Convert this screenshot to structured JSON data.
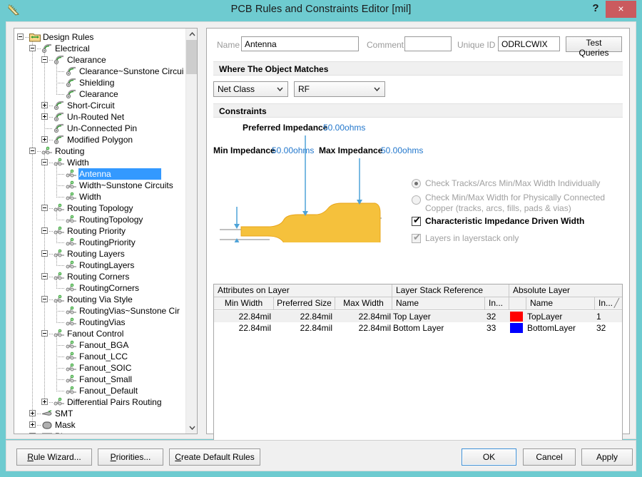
{
  "window": {
    "title": "PCB Rules and Constraints Editor [mil]",
    "help_label": "?",
    "close_label": "×",
    "icon_name": "pcb-ruler-icon"
  },
  "tree": {
    "nodes": [
      {
        "label": "Design Rules",
        "depth": 0,
        "expander": "minus",
        "icon": "folder-rules-icon"
      },
      {
        "label": "Electrical",
        "depth": 1,
        "expander": "minus",
        "icon": "electrical-icon"
      },
      {
        "label": "Clearance",
        "depth": 2,
        "expander": "minus",
        "icon": "electrical-icon"
      },
      {
        "label": "Clearance~Sunstone Circui",
        "depth": 3,
        "expander": "none",
        "icon": "electrical-icon"
      },
      {
        "label": "Shielding",
        "depth": 3,
        "expander": "none",
        "icon": "electrical-icon"
      },
      {
        "label": "Clearance",
        "depth": 3,
        "expander": "none",
        "icon": "electrical-icon"
      },
      {
        "label": "Short-Circuit",
        "depth": 2,
        "expander": "plus",
        "icon": "electrical-icon"
      },
      {
        "label": "Un-Routed Net",
        "depth": 2,
        "expander": "plus",
        "icon": "electrical-icon"
      },
      {
        "label": "Un-Connected Pin",
        "depth": 2,
        "expander": "none",
        "icon": "electrical-icon"
      },
      {
        "label": "Modified Polygon",
        "depth": 2,
        "expander": "plus",
        "icon": "electrical-icon"
      },
      {
        "label": "Routing",
        "depth": 1,
        "expander": "minus",
        "icon": "routing-icon"
      },
      {
        "label": "Width",
        "depth": 2,
        "expander": "minus",
        "icon": "routing-icon"
      },
      {
        "label": "Antenna",
        "depth": 3,
        "expander": "none",
        "icon": "routing-icon",
        "selected": true
      },
      {
        "label": "Width~Sunstone Circuits",
        "depth": 3,
        "expander": "none",
        "icon": "routing-icon"
      },
      {
        "label": "Width",
        "depth": 3,
        "expander": "none",
        "icon": "routing-icon"
      },
      {
        "label": "Routing Topology",
        "depth": 2,
        "expander": "minus",
        "icon": "routing-icon"
      },
      {
        "label": "RoutingTopology",
        "depth": 3,
        "expander": "none",
        "icon": "routing-icon"
      },
      {
        "label": "Routing Priority",
        "depth": 2,
        "expander": "minus",
        "icon": "routing-icon"
      },
      {
        "label": "RoutingPriority",
        "depth": 3,
        "expander": "none",
        "icon": "routing-icon"
      },
      {
        "label": "Routing Layers",
        "depth": 2,
        "expander": "minus",
        "icon": "routing-icon"
      },
      {
        "label": "RoutingLayers",
        "depth": 3,
        "expander": "none",
        "icon": "routing-icon"
      },
      {
        "label": "Routing Corners",
        "depth": 2,
        "expander": "minus",
        "icon": "routing-icon"
      },
      {
        "label": "RoutingCorners",
        "depth": 3,
        "expander": "none",
        "icon": "routing-icon"
      },
      {
        "label": "Routing Via Style",
        "depth": 2,
        "expander": "minus",
        "icon": "routing-icon"
      },
      {
        "label": "RoutingVias~Sunstone Cir",
        "depth": 3,
        "expander": "none",
        "icon": "routing-icon"
      },
      {
        "label": "RoutingVias",
        "depth": 3,
        "expander": "none",
        "icon": "routing-icon"
      },
      {
        "label": "Fanout Control",
        "depth": 2,
        "expander": "minus",
        "icon": "routing-icon"
      },
      {
        "label": "Fanout_BGA",
        "depth": 3,
        "expander": "none",
        "icon": "routing-icon"
      },
      {
        "label": "Fanout_LCC",
        "depth": 3,
        "expander": "none",
        "icon": "routing-icon"
      },
      {
        "label": "Fanout_SOIC",
        "depth": 3,
        "expander": "none",
        "icon": "routing-icon"
      },
      {
        "label": "Fanout_Small",
        "depth": 3,
        "expander": "none",
        "icon": "routing-icon"
      },
      {
        "label": "Fanout_Default",
        "depth": 3,
        "expander": "none",
        "icon": "routing-icon"
      },
      {
        "label": "Differential Pairs Routing",
        "depth": 2,
        "expander": "plus",
        "icon": "routing-icon"
      },
      {
        "label": "SMT",
        "depth": 1,
        "expander": "plus",
        "icon": "smt-icon"
      },
      {
        "label": "Mask",
        "depth": 1,
        "expander": "plus",
        "icon": "mask-icon"
      },
      {
        "label": "Plane",
        "depth": 1,
        "expander": "minus",
        "icon": "plane-icon"
      }
    ],
    "scroll_up_label": "▲",
    "scroll_down_label": "▼"
  },
  "rule": {
    "name_label": "Name",
    "name_value": "Antenna",
    "comment_label": "Comment",
    "comment_value": "",
    "unique_id_label": "Unique ID",
    "unique_id_value": "ODRLCWIX",
    "test_queries_label": "Test Queries"
  },
  "where": {
    "header": "Where The Object Matches",
    "scope_value": "Net Class",
    "target_value": "RF"
  },
  "constraints": {
    "header": "Constraints",
    "preferred_impedance_label": "Preferred Impedance",
    "preferred_impedance_value": "50.00ohms",
    "min_impedance_label": "Min Impedance",
    "min_impedance_value": "50.00ohms",
    "max_impedance_label": "Max Impedance",
    "max_impedance_value": "50.00ohms",
    "radio_individual": "Check Tracks/Arcs Min/Max Width Individually",
    "radio_connected_line1": "Check Min/Max Width for Physically Connected",
    "radio_connected_line2": "Copper (tracks, arcs, fills, pads & vias)",
    "check_impedance_driven": "Characteristic Impedance Driven Width",
    "check_layers_only": "Layers in layerstack only",
    "checkmark": "✔"
  },
  "grid": {
    "group_headers": [
      "Attributes on Layer",
      "Layer Stack Reference",
      "Absolute Layer"
    ],
    "columns": [
      "Min Width",
      "Preferred Size",
      "Max Width",
      "Name",
      "In...",
      "",
      "Name",
      "In..."
    ],
    "sort_indicator": "╱",
    "rows": [
      {
        "min_width": "22.84mil",
        "preferred_size": "22.84mil",
        "max_width": "22.84mil",
        "stack_name": "Top Layer",
        "stack_index": "32",
        "color": "#ff0000",
        "abs_name": "TopLayer",
        "abs_index": "1"
      },
      {
        "min_width": "22.84mil",
        "preferred_size": "22.84mil",
        "max_width": "22.84mil",
        "stack_name": "Bottom Layer",
        "stack_index": "33",
        "color": "#0000ff",
        "abs_name": "BottomLayer",
        "abs_index": "32"
      }
    ]
  },
  "footer": {
    "rule_wizard": "Rule Wizard...",
    "rule_wizard_key": "R",
    "priorities": "Priorities...",
    "priorities_key": "P",
    "create_default_rules": "Create Default Rules",
    "create_default_rules_key": "C",
    "ok": "OK",
    "cancel": "Cancel",
    "apply": "Apply"
  },
  "colors": {
    "window_chrome": "#6ecbd0",
    "close_button": "#ca5a5e",
    "selection": "#3399ff",
    "impedance_text": "#2277cc",
    "trace_fill": "#f5c13c",
    "arrow": "#4ea3d8"
  }
}
